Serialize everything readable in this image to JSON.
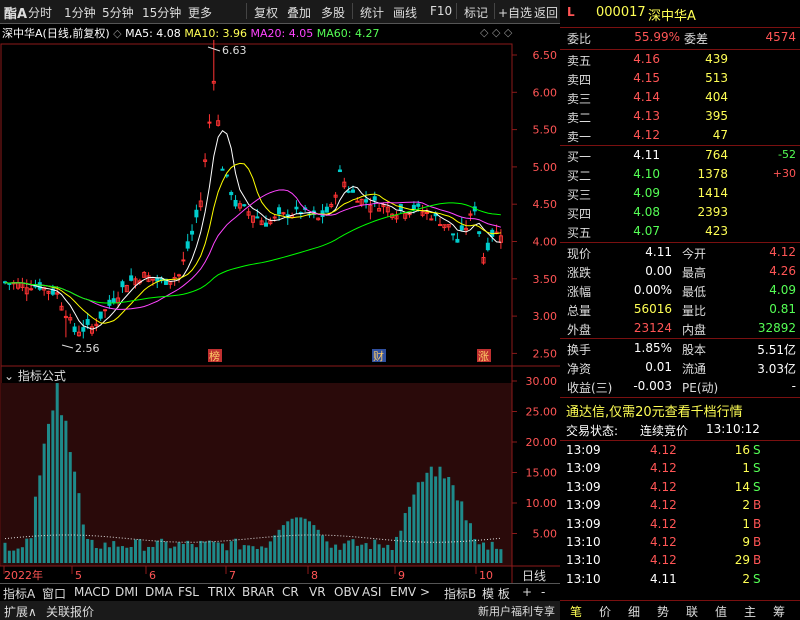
{
  "toolbar": {
    "logo": "酯A",
    "items": [
      "分时",
      "1分钟",
      "5分钟",
      "15分钟",
      "更多",
      "复权",
      "叠加",
      "多股",
      "统计",
      "画线",
      "F10",
      "标记",
      "+自选",
      "返回"
    ]
  },
  "chart": {
    "stock": "深中华A",
    "mode": "(日线,前复权)",
    "ma5": "MA5: 4.08",
    "ma10": "MA10: 3.96",
    "ma20": "MA20: 4.05",
    "ma60": "MA60: 4.27",
    "high_label": "6.63",
    "low_label": "2.56",
    "y_ticks": [
      "6.50",
      "6.00",
      "5.50",
      "5.00",
      "4.50",
      "4.00",
      "3.50",
      "3.00",
      "2.50"
    ],
    "markers": [
      "榜",
      "财",
      "涨"
    ],
    "indicator_title": "指标公式",
    "vol_ticks": [
      "30.00",
      "25.00",
      "20.00",
      "15.00",
      "10.00",
      "5.00"
    ],
    "x_labels": [
      "2022年",
      "5",
      "6",
      "7",
      "8",
      "9",
      "10"
    ],
    "period": "日线",
    "colors": {
      "ma5": "#ffffff",
      "ma10": "#ffff00",
      "ma20": "#ff44ff",
      "ma60": "#00ff00",
      "up": "#ff3333",
      "down": "#00cccc"
    }
  },
  "indicator_tabs": [
    "指标A",
    "窗口",
    "MACD",
    "DMI",
    "DMA",
    "FSL",
    "TRIX",
    "BRAR",
    "CR",
    "VR",
    "OBV",
    "ASI",
    "EMV",
    ">",
    "指标B",
    "模 板",
    "+",
    "-"
  ],
  "bottom": {
    "expand": "扩展∧",
    "related": "关联报价"
  },
  "quote": {
    "flag": "L",
    "code": "000017",
    "name": "深中华A",
    "weibi_label": "委比",
    "weibi": "55.99%",
    "weicha_label": "委差",
    "weicha": "4574",
    "asks": [
      {
        "label": "卖五",
        "price": "4.16",
        "vol": "439"
      },
      {
        "label": "卖四",
        "price": "4.15",
        "vol": "513"
      },
      {
        "label": "卖三",
        "price": "4.14",
        "vol": "404"
      },
      {
        "label": "卖二",
        "price": "4.13",
        "vol": "395"
      },
      {
        "label": "卖一",
        "price": "4.12",
        "vol": "47"
      }
    ],
    "bids": [
      {
        "label": "买一",
        "price": "4.11",
        "vol": "764",
        "chg": "-52"
      },
      {
        "label": "买二",
        "price": "4.10",
        "vol": "1378",
        "chg": "+30"
      },
      {
        "label": "买三",
        "price": "4.09",
        "vol": "1414",
        "chg": ""
      },
      {
        "label": "买四",
        "price": "4.08",
        "vol": "2393",
        "chg": ""
      },
      {
        "label": "买五",
        "price": "4.07",
        "vol": "423",
        "chg": ""
      }
    ],
    "stats": [
      {
        "l1": "现价",
        "v1": "4.11",
        "l2": "今开",
        "v2": "4.12"
      },
      {
        "l1": "涨跌",
        "v1": "0.00",
        "l2": "最高",
        "v2": "4.26"
      },
      {
        "l1": "涨幅",
        "v1": "0.00%",
        "l2": "最低",
        "v2": "4.09"
      },
      {
        "l1": "总量",
        "v1": "56016",
        "l2": "量比",
        "v2": "0.81"
      },
      {
        "l1": "外盘",
        "v1": "23124",
        "l2": "内盘",
        "v2": "32892"
      }
    ],
    "stats2": [
      {
        "l1": "换手",
        "v1": "1.85%",
        "l2": "股本",
        "v2": "5.51亿"
      },
      {
        "l1": "净资",
        "v1": "0.01",
        "l2": "流通",
        "v2": "3.03亿"
      },
      {
        "l1": "收益(三)",
        "v1": "-0.003",
        "l2": "PE(动)",
        "v2": "-"
      }
    ],
    "promo": "通达信,仅需20元查看千档行情",
    "status_label": "交易状态:",
    "status": "连续竞价",
    "status_time": "13:10:12",
    "ticks": [
      {
        "t": "13:09",
        "p": "4.12",
        "v": "16",
        "s": "S"
      },
      {
        "t": "13:09",
        "p": "4.12",
        "v": "1",
        "s": "S"
      },
      {
        "t": "13:09",
        "p": "4.12",
        "v": "14",
        "s": "S"
      },
      {
        "t": "13:09",
        "p": "4.12",
        "v": "2",
        "s": "B"
      },
      {
        "t": "13:09",
        "p": "4.12",
        "v": "1",
        "s": "B"
      },
      {
        "t": "13:10",
        "p": "4.12",
        "v": "9",
        "s": "B"
      },
      {
        "t": "13:10",
        "p": "4.12",
        "v": "29",
        "s": "B"
      },
      {
        "t": "13:10",
        "p": "4.11",
        "v": "2",
        "s": "S"
      }
    ],
    "tabs": [
      "笔",
      "价",
      "细",
      "势",
      "联",
      "值",
      "主",
      "筹"
    ],
    "welfare": "新用户福利专享"
  }
}
